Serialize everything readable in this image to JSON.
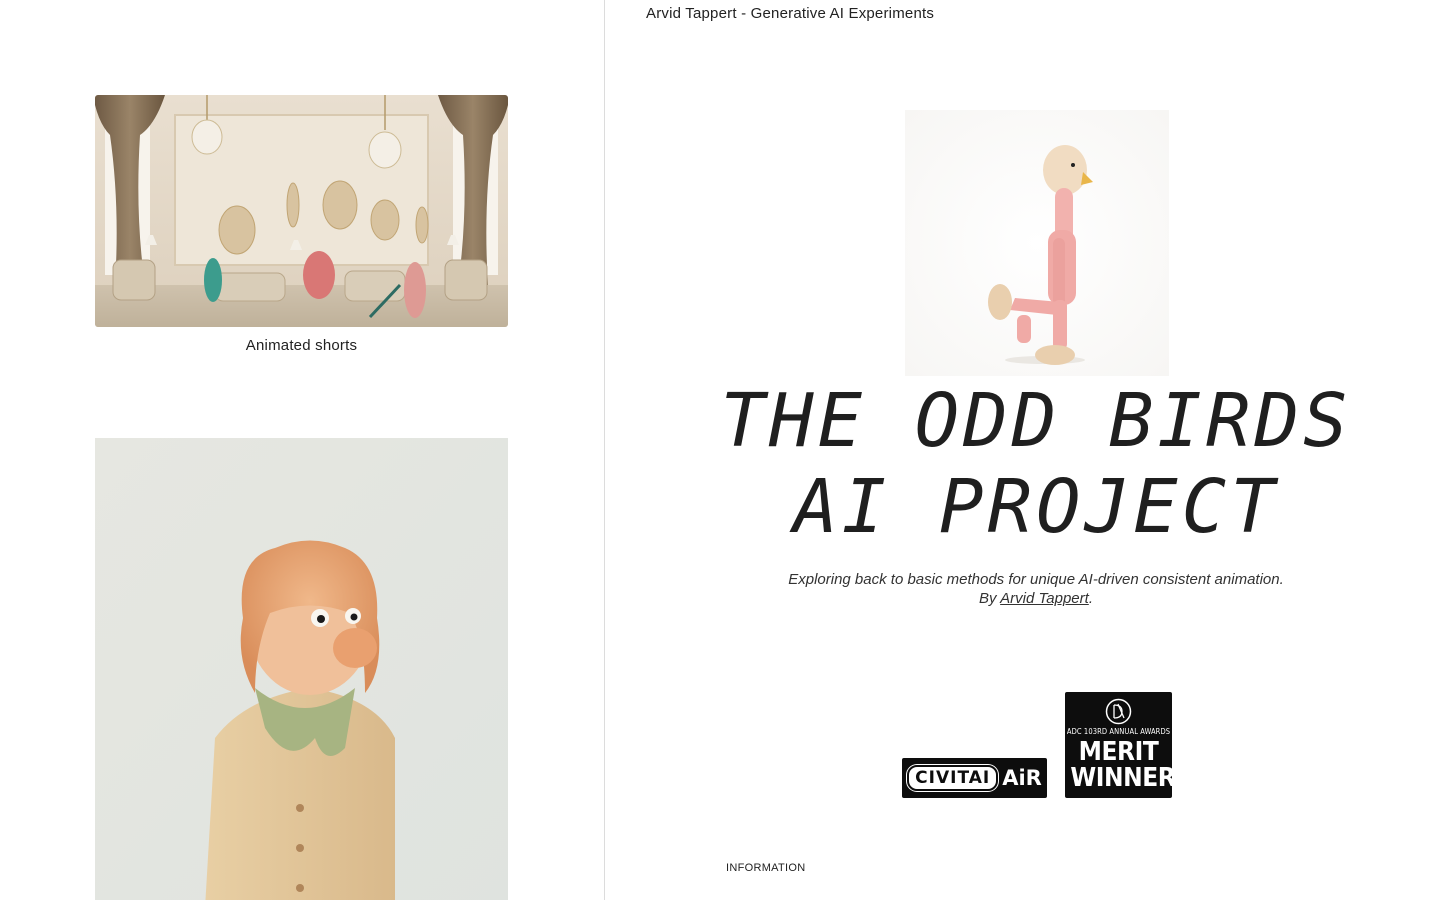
{
  "header": {
    "site_title": "Arvid Tappert - Generative AI Experiments"
  },
  "sidebar": {
    "items": [
      {
        "caption": "Animated shorts",
        "image": "living-room-still"
      },
      {
        "caption": "",
        "image": "bird-character-portrait"
      }
    ]
  },
  "hero": {
    "image": "pink-bird-figure",
    "headline_line1": "THE ODD BIRDS",
    "headline_line2": "AI PROJECT",
    "subtitle_line1": "Exploring back to basic methods for unique AI-driven consistent animation.",
    "subtitle_by": "By ",
    "author_link": "Arvid Tappert",
    "subtitle_end": "."
  },
  "badges": {
    "civitai_left": "CIVITAI",
    "civitai_right": "AiR",
    "adc_line": "ADC 103RD ANNUAL AWARDS",
    "adc_merit": "MERIT",
    "adc_winner": "WINNER"
  },
  "footer": {
    "info_label": "INFORMATION"
  },
  "colors": {
    "background": "#ffffff",
    "text": "#222222",
    "divider": "#dcdcdc",
    "badge_bg": "#0d0d0d"
  }
}
